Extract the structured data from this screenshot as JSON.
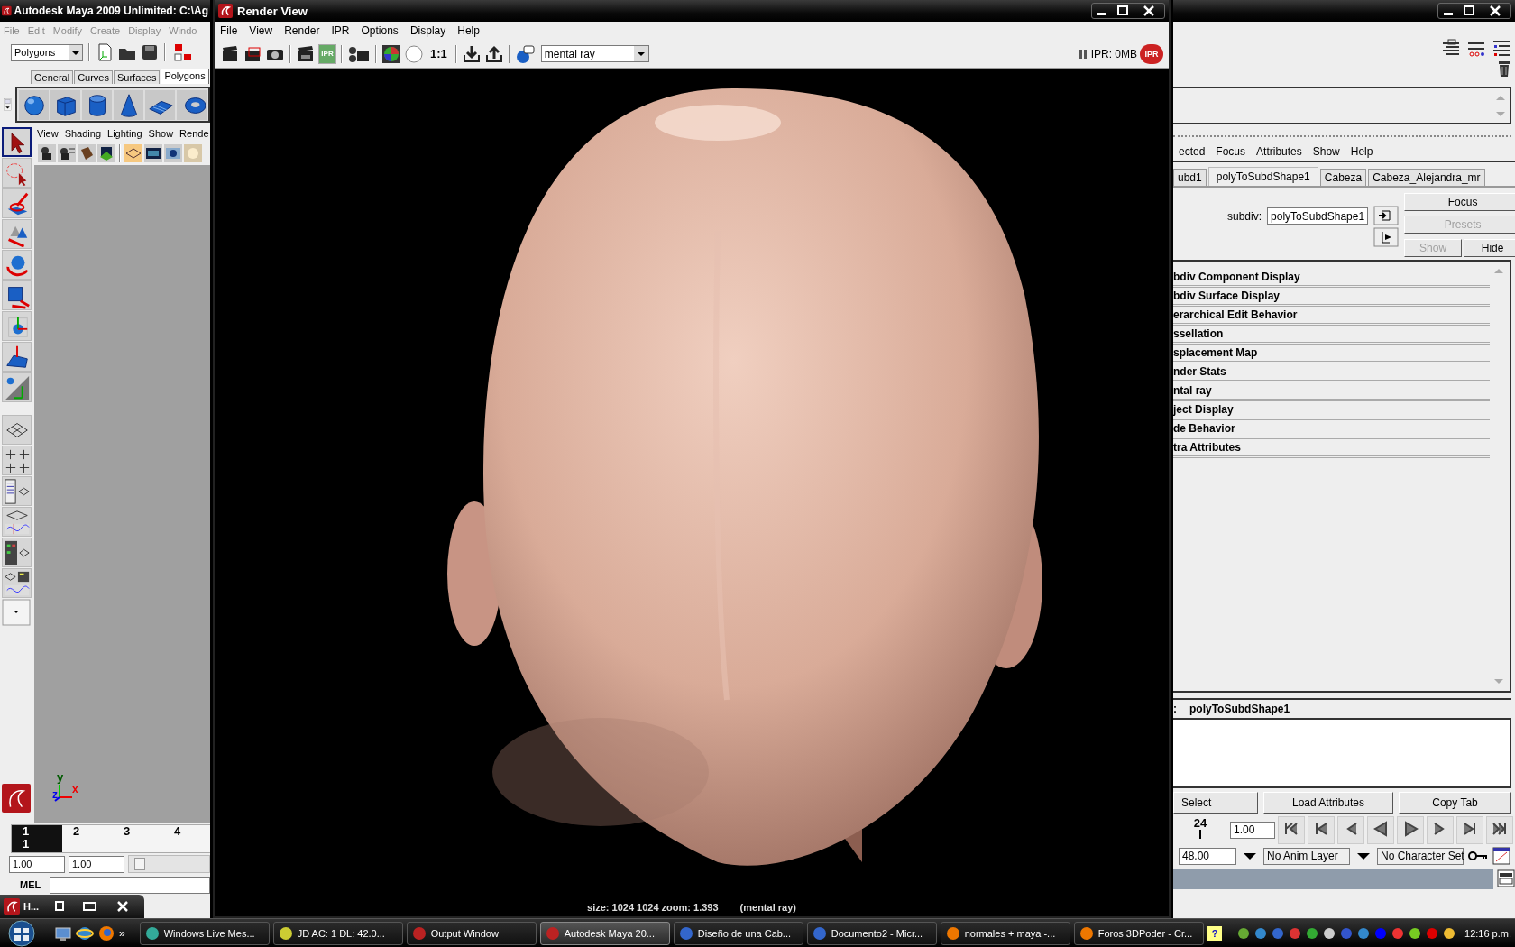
{
  "maya_window": {
    "title": "Autodesk Maya 2009 Unlimited: C:\\Ag",
    "menu": [
      "File",
      "Edit",
      "Modify",
      "Create",
      "Display",
      "Windo"
    ],
    "menu_set": "Polygons",
    "shelf_tabs": [
      {
        "label": "General",
        "selected": false
      },
      {
        "label": "Curves",
        "selected": false
      },
      {
        "label": "Surfaces",
        "selected": false
      },
      {
        "label": "Polygons",
        "selected": true
      }
    ],
    "panel_menu": [
      "View",
      "Shading",
      "Lighting",
      "Show",
      "Rende"
    ],
    "axis": {
      "y": "y",
      "z": "z",
      "x": "x"
    },
    "timeline": {
      "ticks": [
        {
          "label": "1",
          "selected": true
        },
        {
          "label": "2",
          "selected": false
        },
        {
          "label": "3",
          "selected": false
        },
        {
          "label": "4",
          "selected": false
        }
      ],
      "current": "1"
    },
    "range": {
      "start": "1.00",
      "playback_start": "1.00"
    },
    "command_line": {
      "label": "MEL"
    },
    "minimized_window": {
      "title": "H..."
    }
  },
  "render_view": {
    "title": "Render View",
    "menu": [
      "File",
      "View",
      "Render",
      "IPR",
      "Options",
      "Display",
      "Help"
    ],
    "ipr_button": "IPR",
    "ratio_button": "1:1",
    "renderer": "mental ray",
    "ipr_memory": "IPR: 0MB",
    "ipr_stop": "IPR",
    "status": "size: 1024 1024 zoom: 1.393",
    "status_renderer": "(mental ray)",
    "image": {
      "kind": "picture"
    }
  },
  "attribute_editor": {
    "menu": [
      "ected",
      "Focus",
      "Attributes",
      "Show",
      "Help"
    ],
    "tabs": [
      {
        "label": "ubd1",
        "selected": false
      },
      {
        "label": "polyToSubdShape1",
        "selected": true
      },
      {
        "label": "Cabeza",
        "selected": false
      },
      {
        "label": "Cabeza_Alejandra_mr",
        "selected": false
      }
    ],
    "node_label": "subdiv:",
    "node_name": "polyToSubdShape1",
    "buttons": [
      {
        "label": "Focus",
        "disabled": false
      },
      {
        "label": "Presets",
        "disabled": true
      },
      {
        "label": "Show",
        "disabled": true
      },
      {
        "label": "Hide",
        "disabled": false
      }
    ],
    "sections": [
      "bdiv Component Display",
      "bdiv Surface Display",
      "erarchical Edit Behavior",
      "ssellation",
      "splacement Map",
      "nder Stats",
      "ntal ray",
      "ject Display",
      "de Behavior",
      "tra Attributes"
    ],
    "notes_prefix": ":",
    "notes_node": "polyToSubdShape1",
    "actions": [
      "Select",
      "Load Attributes",
      "Copy Tab"
    ]
  },
  "time_controls": {
    "tick": "24",
    "current_time": "1.00",
    "end_time": "48.00",
    "anim_layer": "No Anim Layer",
    "character_set": "No Character Set"
  },
  "taskbar": {
    "more": "»",
    "items": [
      {
        "label": "Windows Live Mes...",
        "selected": false
      },
      {
        "label": "JD AC: 1 DL: 42.0...",
        "selected": false
      },
      {
        "label": "Output Window",
        "selected": false
      },
      {
        "label": "Autodesk Maya 20...",
        "selected": true
      },
      {
        "label": "Diseño de una Cab...",
        "selected": false
      },
      {
        "label": "Documento2 - Micr...",
        "selected": false
      },
      {
        "label": "normales + maya -...",
        "selected": false
      },
      {
        "label": "Foros 3DPoder - Cr...",
        "selected": false
      }
    ],
    "help": "?",
    "clock": "12:16 p.m."
  }
}
